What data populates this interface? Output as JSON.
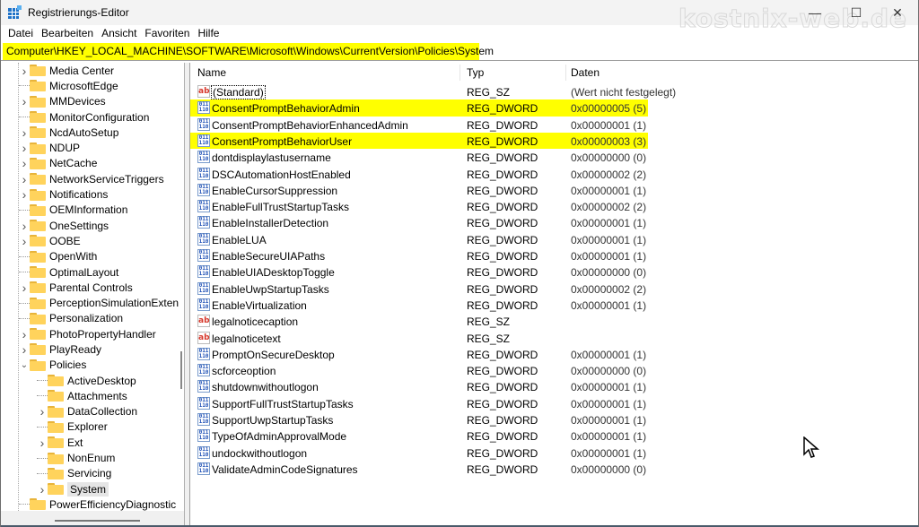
{
  "window": {
    "title": "Registrierungs-Editor",
    "watermark": "kostnix-web.de",
    "controls": {
      "minimize": "—",
      "maximize": "☐",
      "close": "✕"
    }
  },
  "menu": [
    "Datei",
    "Bearbeiten",
    "Ansicht",
    "Favoriten",
    "Hilfe"
  ],
  "address": {
    "value": "Computer\\HKEY_LOCAL_MACHINE\\SOFTWARE\\Microsoft\\Windows\\CurrentVersion\\Policies\\System",
    "highlight_color": "#ffff00"
  },
  "tree": [
    {
      "label": "Media Center",
      "level": 0,
      "expander": "collapsed"
    },
    {
      "label": "MicrosoftEdge",
      "level": 0,
      "expander": "none"
    },
    {
      "label": "MMDevices",
      "level": 0,
      "expander": "collapsed"
    },
    {
      "label": "MonitorConfiguration",
      "level": 0,
      "expander": "none"
    },
    {
      "label": "NcdAutoSetup",
      "level": 0,
      "expander": "collapsed"
    },
    {
      "label": "NDUP",
      "level": 0,
      "expander": "collapsed"
    },
    {
      "label": "NetCache",
      "level": 0,
      "expander": "collapsed"
    },
    {
      "label": "NetworkServiceTriggers",
      "level": 0,
      "expander": "collapsed"
    },
    {
      "label": "Notifications",
      "level": 0,
      "expander": "collapsed"
    },
    {
      "label": "OEMInformation",
      "level": 0,
      "expander": "none"
    },
    {
      "label": "OneSettings",
      "level": 0,
      "expander": "collapsed"
    },
    {
      "label": "OOBE",
      "level": 0,
      "expander": "collapsed"
    },
    {
      "label": "OpenWith",
      "level": 0,
      "expander": "none"
    },
    {
      "label": "OptimalLayout",
      "level": 0,
      "expander": "none"
    },
    {
      "label": "Parental Controls",
      "level": 0,
      "expander": "collapsed"
    },
    {
      "label": "PerceptionSimulationExten",
      "level": 0,
      "expander": "none"
    },
    {
      "label": "Personalization",
      "level": 0,
      "expander": "none"
    },
    {
      "label": "PhotoPropertyHandler",
      "level": 0,
      "expander": "collapsed"
    },
    {
      "label": "PlayReady",
      "level": 0,
      "expander": "collapsed"
    },
    {
      "label": "Policies",
      "level": 0,
      "expander": "expanded"
    },
    {
      "label": "ActiveDesktop",
      "level": 1,
      "expander": "none"
    },
    {
      "label": "Attachments",
      "level": 1,
      "expander": "none"
    },
    {
      "label": "DataCollection",
      "level": 1,
      "expander": "collapsed"
    },
    {
      "label": "Explorer",
      "level": 1,
      "expander": "none"
    },
    {
      "label": "Ext",
      "level": 1,
      "expander": "collapsed"
    },
    {
      "label": "NonEnum",
      "level": 1,
      "expander": "none"
    },
    {
      "label": "Servicing",
      "level": 1,
      "expander": "none"
    },
    {
      "label": "System",
      "level": 1,
      "expander": "collapsed",
      "selected": true
    },
    {
      "label": "PowerEfficiencyDiagnostic",
      "level": 0,
      "expander": "none"
    }
  ],
  "list": {
    "columns": {
      "name": "Name",
      "type": "Typ",
      "data": "Daten"
    },
    "rows": [
      {
        "name": "(Standard)",
        "type": "REG_SZ",
        "data": "(Wert nicht festgelegt)",
        "icon": "string-value-icon",
        "focused": true
      },
      {
        "name": "ConsentPromptBehaviorAdmin",
        "type": "REG_DWORD",
        "data": "0x00000005 (5)",
        "icon": "binary-value-icon",
        "highlighted": true
      },
      {
        "name": "ConsentPromptBehaviorEnhancedAdmin",
        "type": "REG_DWORD",
        "data": "0x00000001 (1)",
        "icon": "binary-value-icon"
      },
      {
        "name": "ConsentPromptBehaviorUser",
        "type": "REG_DWORD",
        "data": "0x00000003 (3)",
        "icon": "binary-value-icon",
        "highlighted": true
      },
      {
        "name": "dontdisplaylastusername",
        "type": "REG_DWORD",
        "data": "0x00000000 (0)",
        "icon": "binary-value-icon"
      },
      {
        "name": "DSCAutomationHostEnabled",
        "type": "REG_DWORD",
        "data": "0x00000002 (2)",
        "icon": "binary-value-icon"
      },
      {
        "name": "EnableCursorSuppression",
        "type": "REG_DWORD",
        "data": "0x00000001 (1)",
        "icon": "binary-value-icon"
      },
      {
        "name": "EnableFullTrustStartupTasks",
        "type": "REG_DWORD",
        "data": "0x00000002 (2)",
        "icon": "binary-value-icon"
      },
      {
        "name": "EnableInstallerDetection",
        "type": "REG_DWORD",
        "data": "0x00000001 (1)",
        "icon": "binary-value-icon"
      },
      {
        "name": "EnableLUA",
        "type": "REG_DWORD",
        "data": "0x00000001 (1)",
        "icon": "binary-value-icon"
      },
      {
        "name": "EnableSecureUIAPaths",
        "type": "REG_DWORD",
        "data": "0x00000001 (1)",
        "icon": "binary-value-icon"
      },
      {
        "name": "EnableUIADesktopToggle",
        "type": "REG_DWORD",
        "data": "0x00000000 (0)",
        "icon": "binary-value-icon"
      },
      {
        "name": "EnableUwpStartupTasks",
        "type": "REG_DWORD",
        "data": "0x00000002 (2)",
        "icon": "binary-value-icon"
      },
      {
        "name": "EnableVirtualization",
        "type": "REG_DWORD",
        "data": "0x00000001 (1)",
        "icon": "binary-value-icon"
      },
      {
        "name": "legalnoticecaption",
        "type": "REG_SZ",
        "data": "",
        "icon": "string-value-icon"
      },
      {
        "name": "legalnoticetext",
        "type": "REG_SZ",
        "data": "",
        "icon": "string-value-icon"
      },
      {
        "name": "PromptOnSecureDesktop",
        "type": "REG_DWORD",
        "data": "0x00000001 (1)",
        "icon": "binary-value-icon"
      },
      {
        "name": "scforceoption",
        "type": "REG_DWORD",
        "data": "0x00000000 (0)",
        "icon": "binary-value-icon"
      },
      {
        "name": "shutdownwithoutlogon",
        "type": "REG_DWORD",
        "data": "0x00000001 (1)",
        "icon": "binary-value-icon"
      },
      {
        "name": "SupportFullTrustStartupTasks",
        "type": "REG_DWORD",
        "data": "0x00000001 (1)",
        "icon": "binary-value-icon"
      },
      {
        "name": "SupportUwpStartupTasks",
        "type": "REG_DWORD",
        "data": "0x00000001 (1)",
        "icon": "binary-value-icon"
      },
      {
        "name": "TypeOfAdminApprovalMode",
        "type": "REG_DWORD",
        "data": "0x00000001 (1)",
        "icon": "binary-value-icon"
      },
      {
        "name": "undockwithoutlogon",
        "type": "REG_DWORD",
        "data": "0x00000001 (1)",
        "icon": "binary-value-icon"
      },
      {
        "name": "ValidateAdminCodeSignatures",
        "type": "REG_DWORD",
        "data": "0x00000000 (0)",
        "icon": "binary-value-icon"
      }
    ]
  }
}
